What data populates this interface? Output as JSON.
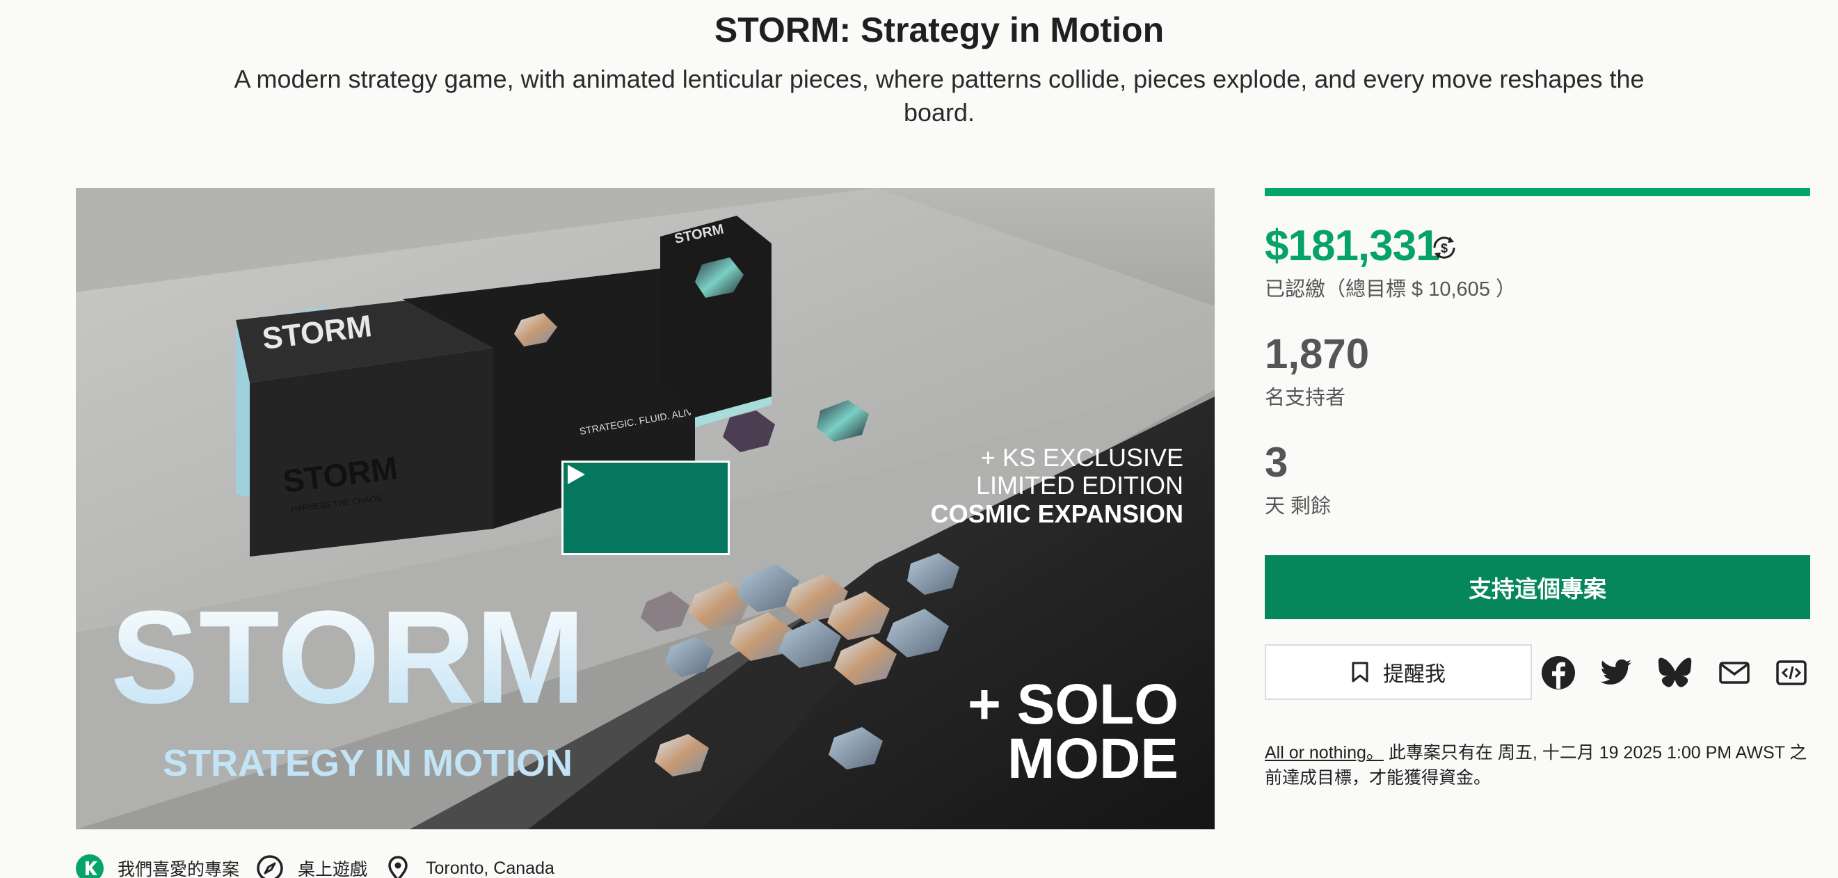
{
  "project": {
    "title": "STORM: Strategy in Motion",
    "blurb": "A modern strategy game, with animated lenticular pieces, where patterns collide, pieces explode, and every move reshapes the board."
  },
  "media": {
    "box_brand": "STORM",
    "box_tagline": "HARNESS THE CHAOS",
    "box_side_text": "STRATEGIC. FLUID. ALIVE.",
    "overlay_ks_line1": "+ KS EXCLUSIVE",
    "overlay_ks_line2": "LIMITED EDITION",
    "overlay_ks_line3": "COSMIC EXPANSION",
    "overlay_logo": "STORM",
    "overlay_logo_sub": "STRATEGY IN MOTION",
    "overlay_solo_line1": "+ SOLO",
    "overlay_solo_line2": "MODE"
  },
  "stats": {
    "funded_fraction": 1.0,
    "pledged": "$181,331",
    "goal_text": "已認繳（總目標 $ 10,605 ）",
    "backers": "1,870",
    "backers_label": "名支持者",
    "days": "3",
    "days_label": "天 剩餘"
  },
  "actions": {
    "back_label": "支持這個專案",
    "remind_label": "提醒我"
  },
  "share_icons": [
    "facebook-icon",
    "twitter-icon",
    "bluesky-icon",
    "email-icon",
    "embed-icon"
  ],
  "funding": {
    "link": "All or nothing。",
    "text": " 此專案只有在 周五, 十二月 19 2025 1:00 PM AWST 之前達成目標，才能獲得資金。"
  },
  "tags": [
    {
      "icon": "kickstarter-icon",
      "label": "我們喜愛的專案"
    },
    {
      "icon": "compass-icon",
      "label": "桌上遊戲"
    },
    {
      "icon": "location-pin-icon",
      "label": "Toronto, Canada"
    }
  ],
  "colors": {
    "accent_green": "#05a46b",
    "button_green": "#05875b",
    "play_green": "#05775e"
  }
}
